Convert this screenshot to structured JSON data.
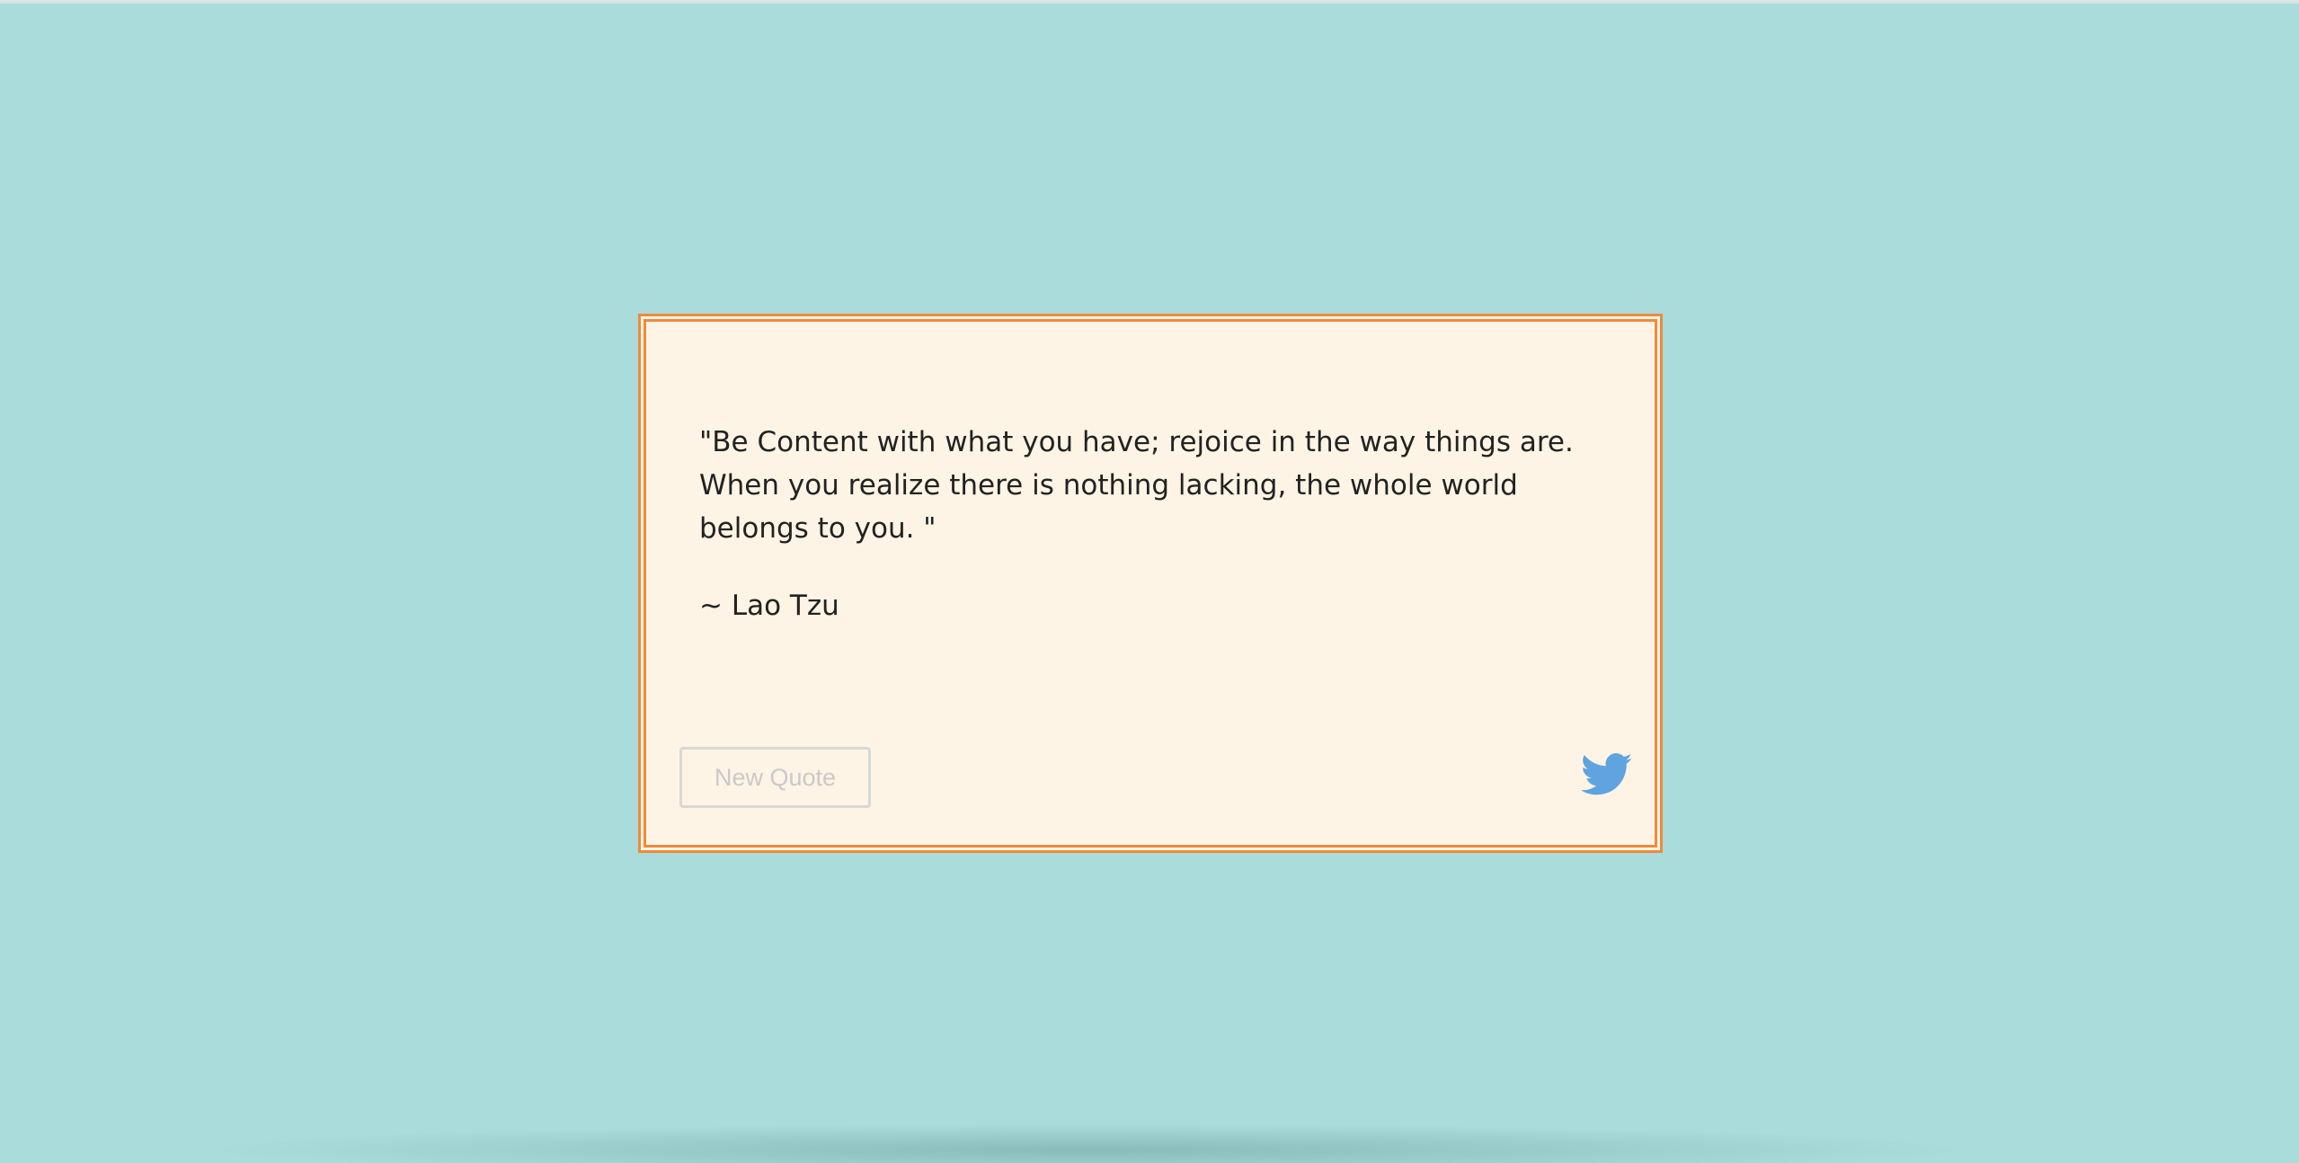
{
  "quote": {
    "text": "\"Be Content with what you have; rejoice in the way things are. When you realize there is nothing lacking, the whole world belongs to you. \"",
    "author": "~ Lao Tzu"
  },
  "actions": {
    "new_quote_label": "New Quote",
    "tweet_icon": "twitter-bird-icon"
  },
  "colors": {
    "background": "#aadcdb",
    "card_background": "#fdf4e5",
    "card_border": "#f08a3a",
    "text": "#222222",
    "button_text": "#c9c9c9",
    "twitter_blue": "#5fa3df"
  }
}
